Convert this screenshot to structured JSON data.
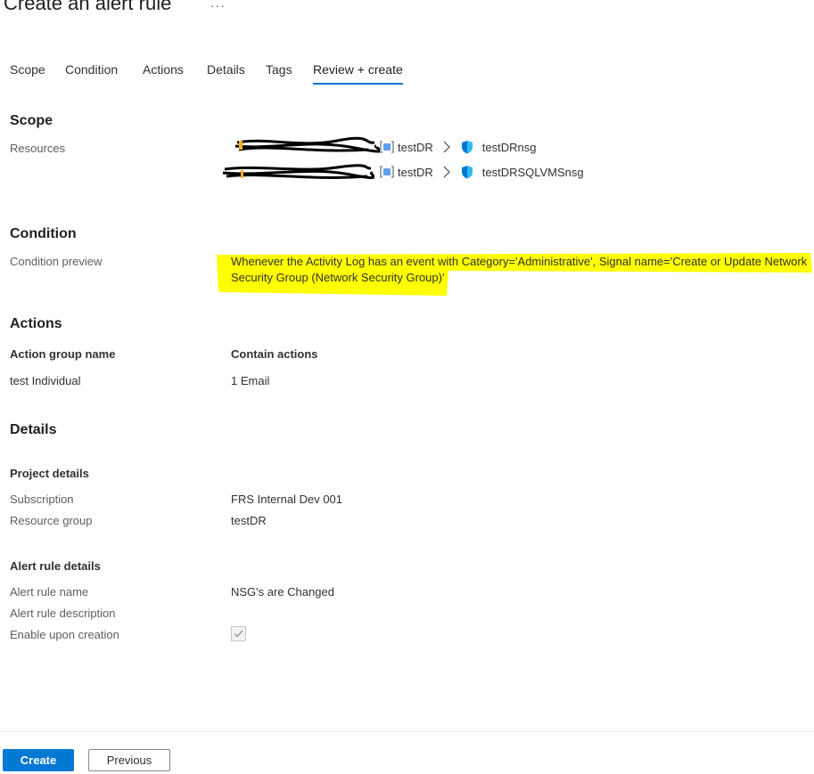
{
  "page": {
    "title": "Create an alert rule",
    "more_label": "···"
  },
  "tabs": [
    {
      "label": "Scope"
    },
    {
      "label": "Condition"
    },
    {
      "label": "Actions"
    },
    {
      "label": "Details"
    },
    {
      "label": "Tags"
    },
    {
      "label": "Review + create",
      "active": true
    }
  ],
  "scope": {
    "heading": "Scope",
    "resources_label": "Resources",
    "resources": [
      {
        "resource_group": "testDR",
        "name": "testDRnsg"
      },
      {
        "resource_group": "testDR",
        "name": "testDRSQLVMSnsg"
      }
    ]
  },
  "condition": {
    "heading": "Condition",
    "preview_label": "Condition preview",
    "preview_text": "Whenever the Activity Log has an event with Category='Administrative', Signal name='Create or Update Network Security Group (Network Security Group)'",
    "highlight_color": "#ffff00"
  },
  "actions": {
    "heading": "Actions",
    "col_group": "Action group name",
    "col_actions": "Contain actions",
    "rows": [
      {
        "group": "test Individual",
        "actions": "1 Email"
      }
    ]
  },
  "details": {
    "heading": "Details",
    "project_heading": "Project details",
    "subscription_label": "Subscription",
    "subscription_value": "FRS Internal Dev 001",
    "resource_group_label": "Resource group",
    "resource_group_value": "testDR",
    "alert_heading": "Alert rule details",
    "rule_name_label": "Alert rule name",
    "rule_name_value": "NSG's are Changed",
    "rule_desc_label": "Alert rule description",
    "enable_label": "Enable upon creation",
    "enable_checked": true
  },
  "footer": {
    "create_label": "Create",
    "previous_label": "Previous"
  },
  "colors": {
    "accent": "#0078d4",
    "shield": "#0078d4"
  },
  "icons": {
    "resource_group": "resource-group-icon",
    "chevron": "chevron-right-icon",
    "nsg": "shield-icon"
  }
}
